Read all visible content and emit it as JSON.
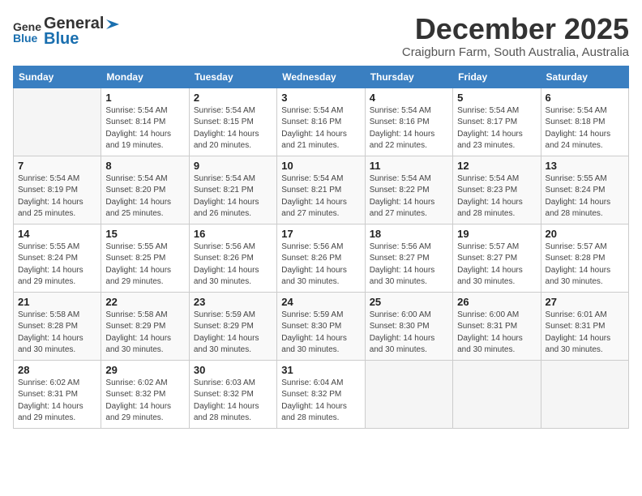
{
  "header": {
    "logo_line1": "General",
    "logo_line2": "Blue",
    "month": "December 2025",
    "location": "Craigburn Farm, South Australia, Australia"
  },
  "weekdays": [
    "Sunday",
    "Monday",
    "Tuesday",
    "Wednesday",
    "Thursday",
    "Friday",
    "Saturday"
  ],
  "weeks": [
    [
      {
        "day": "",
        "info": ""
      },
      {
        "day": "1",
        "info": "Sunrise: 5:54 AM\nSunset: 8:14 PM\nDaylight: 14 hours\nand 19 minutes."
      },
      {
        "day": "2",
        "info": "Sunrise: 5:54 AM\nSunset: 8:15 PM\nDaylight: 14 hours\nand 20 minutes."
      },
      {
        "day": "3",
        "info": "Sunrise: 5:54 AM\nSunset: 8:16 PM\nDaylight: 14 hours\nand 21 minutes."
      },
      {
        "day": "4",
        "info": "Sunrise: 5:54 AM\nSunset: 8:16 PM\nDaylight: 14 hours\nand 22 minutes."
      },
      {
        "day": "5",
        "info": "Sunrise: 5:54 AM\nSunset: 8:17 PM\nDaylight: 14 hours\nand 23 minutes."
      },
      {
        "day": "6",
        "info": "Sunrise: 5:54 AM\nSunset: 8:18 PM\nDaylight: 14 hours\nand 24 minutes."
      }
    ],
    [
      {
        "day": "7",
        "info": "Sunrise: 5:54 AM\nSunset: 8:19 PM\nDaylight: 14 hours\nand 25 minutes."
      },
      {
        "day": "8",
        "info": "Sunrise: 5:54 AM\nSunset: 8:20 PM\nDaylight: 14 hours\nand 25 minutes."
      },
      {
        "day": "9",
        "info": "Sunrise: 5:54 AM\nSunset: 8:21 PM\nDaylight: 14 hours\nand 26 minutes."
      },
      {
        "day": "10",
        "info": "Sunrise: 5:54 AM\nSunset: 8:21 PM\nDaylight: 14 hours\nand 27 minutes."
      },
      {
        "day": "11",
        "info": "Sunrise: 5:54 AM\nSunset: 8:22 PM\nDaylight: 14 hours\nand 27 minutes."
      },
      {
        "day": "12",
        "info": "Sunrise: 5:54 AM\nSunset: 8:23 PM\nDaylight: 14 hours\nand 28 minutes."
      },
      {
        "day": "13",
        "info": "Sunrise: 5:55 AM\nSunset: 8:24 PM\nDaylight: 14 hours\nand 28 minutes."
      }
    ],
    [
      {
        "day": "14",
        "info": "Sunrise: 5:55 AM\nSunset: 8:24 PM\nDaylight: 14 hours\nand 29 minutes."
      },
      {
        "day": "15",
        "info": "Sunrise: 5:55 AM\nSunset: 8:25 PM\nDaylight: 14 hours\nand 29 minutes."
      },
      {
        "day": "16",
        "info": "Sunrise: 5:56 AM\nSunset: 8:26 PM\nDaylight: 14 hours\nand 30 minutes."
      },
      {
        "day": "17",
        "info": "Sunrise: 5:56 AM\nSunset: 8:26 PM\nDaylight: 14 hours\nand 30 minutes."
      },
      {
        "day": "18",
        "info": "Sunrise: 5:56 AM\nSunset: 8:27 PM\nDaylight: 14 hours\nand 30 minutes."
      },
      {
        "day": "19",
        "info": "Sunrise: 5:57 AM\nSunset: 8:27 PM\nDaylight: 14 hours\nand 30 minutes."
      },
      {
        "day": "20",
        "info": "Sunrise: 5:57 AM\nSunset: 8:28 PM\nDaylight: 14 hours\nand 30 minutes."
      }
    ],
    [
      {
        "day": "21",
        "info": "Sunrise: 5:58 AM\nSunset: 8:28 PM\nDaylight: 14 hours\nand 30 minutes."
      },
      {
        "day": "22",
        "info": "Sunrise: 5:58 AM\nSunset: 8:29 PM\nDaylight: 14 hours\nand 30 minutes."
      },
      {
        "day": "23",
        "info": "Sunrise: 5:59 AM\nSunset: 8:29 PM\nDaylight: 14 hours\nand 30 minutes."
      },
      {
        "day": "24",
        "info": "Sunrise: 5:59 AM\nSunset: 8:30 PM\nDaylight: 14 hours\nand 30 minutes."
      },
      {
        "day": "25",
        "info": "Sunrise: 6:00 AM\nSunset: 8:30 PM\nDaylight: 14 hours\nand 30 minutes."
      },
      {
        "day": "26",
        "info": "Sunrise: 6:00 AM\nSunset: 8:31 PM\nDaylight: 14 hours\nand 30 minutes."
      },
      {
        "day": "27",
        "info": "Sunrise: 6:01 AM\nSunset: 8:31 PM\nDaylight: 14 hours\nand 30 minutes."
      }
    ],
    [
      {
        "day": "28",
        "info": "Sunrise: 6:02 AM\nSunset: 8:31 PM\nDaylight: 14 hours\nand 29 minutes."
      },
      {
        "day": "29",
        "info": "Sunrise: 6:02 AM\nSunset: 8:32 PM\nDaylight: 14 hours\nand 29 minutes."
      },
      {
        "day": "30",
        "info": "Sunrise: 6:03 AM\nSunset: 8:32 PM\nDaylight: 14 hours\nand 28 minutes."
      },
      {
        "day": "31",
        "info": "Sunrise: 6:04 AM\nSunset: 8:32 PM\nDaylight: 14 hours\nand 28 minutes."
      },
      {
        "day": "",
        "info": ""
      },
      {
        "day": "",
        "info": ""
      },
      {
        "day": "",
        "info": ""
      }
    ]
  ]
}
